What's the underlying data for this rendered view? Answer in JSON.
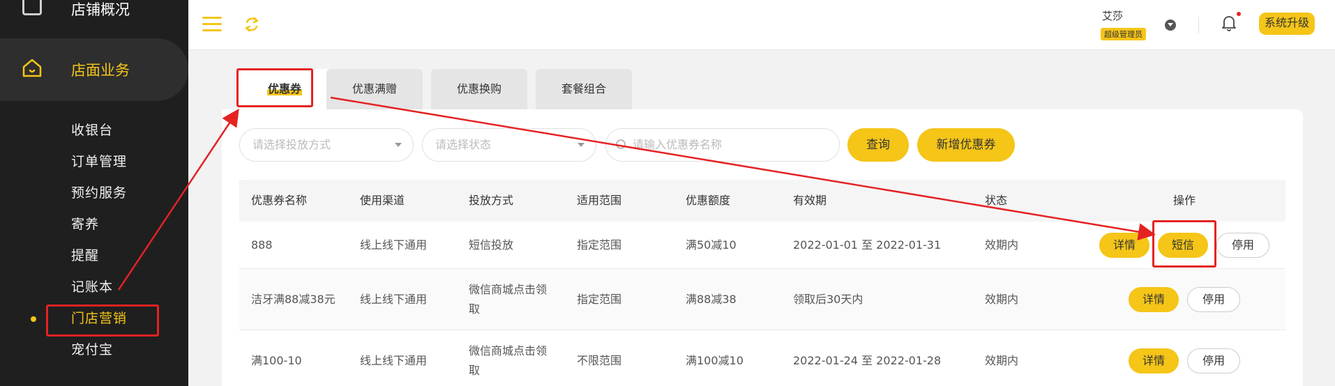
{
  "sidebar": {
    "top_item": "店铺概况",
    "section": "店面业务",
    "items": [
      "收银台",
      "订单管理",
      "预约服务",
      "寄养",
      "提醒",
      "记账本",
      "门店营销",
      "宠付宝"
    ],
    "active_index": 6
  },
  "header": {
    "user_name": "艾莎",
    "role": "超级管理员",
    "upgrade_label": "系统升级"
  },
  "tabs": [
    "优惠券",
    "优惠满赠",
    "优惠换购",
    "套餐组合"
  ],
  "filters": {
    "method_placeholder": "请选择投放方式",
    "status_placeholder": "请选择状态",
    "search_placeholder": "请输入优惠券名称",
    "query_label": "查询",
    "add_label": "新增优惠券"
  },
  "table": {
    "headers": [
      "优惠券名称",
      "使用渠道",
      "投放方式",
      "适用范围",
      "优惠额度",
      "有效期",
      "状态",
      "操作"
    ],
    "rows": [
      {
        "name": "888",
        "channel": "线上线下通用",
        "method": "短信投放",
        "method2": "",
        "scope": "指定范围",
        "amount": "满50减10",
        "validity": "2022-01-01 至 2022-01-31",
        "status": "效期内",
        "actions": [
          "详情",
          "短信",
          "停用"
        ]
      },
      {
        "name": "洁牙满88减38元",
        "channel": "线上线下通用",
        "method": "微信商城点击领",
        "method2": "取",
        "scope": "指定范围",
        "amount": "满88减38",
        "validity": "领取后30天内",
        "status": "效期内",
        "actions": [
          "详情",
          "停用"
        ]
      },
      {
        "name": "满100-10",
        "channel": "线上线下通用",
        "method": "微信商城点击领",
        "method2": "取",
        "scope": "不限范围",
        "amount": "满100减10",
        "validity": "2022-01-24 至 2022-01-28",
        "status": "效期内",
        "actions": [
          "详情",
          "停用"
        ]
      }
    ]
  },
  "colors": {
    "accent": "#f5c518",
    "annotation": "#e52222",
    "sidebar_bg": "#1f1f1f"
  }
}
